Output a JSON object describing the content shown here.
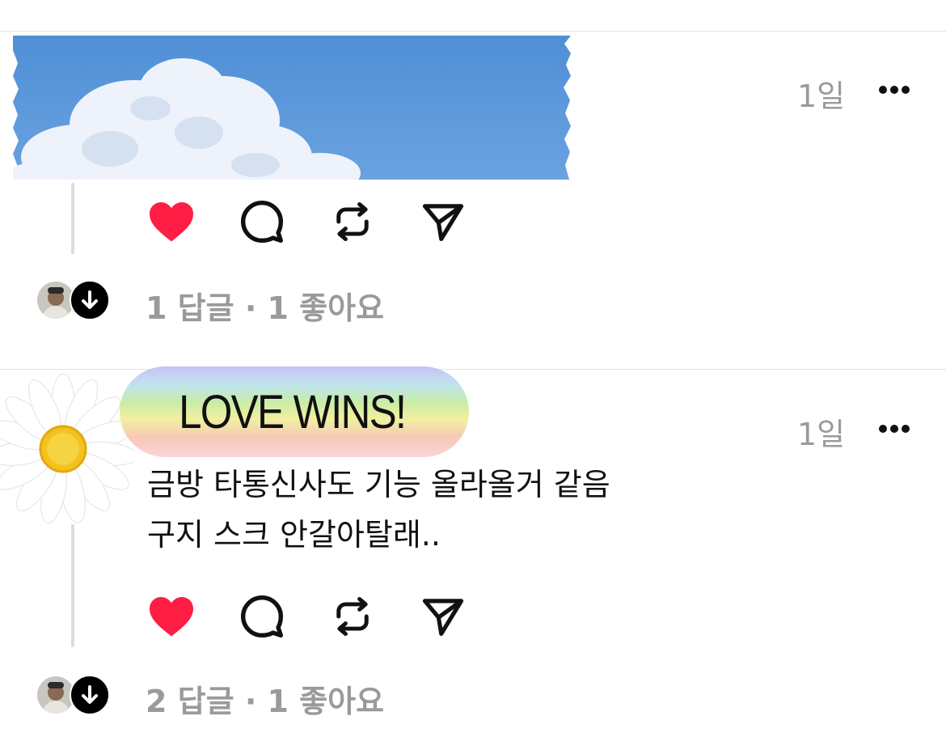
{
  "posts": [
    {
      "time": "1일",
      "more_icon": "more-horizontal-icon",
      "liked": true,
      "stats": "1 답글 · 1 좋아요"
    },
    {
      "badge": "LOVE WINS!",
      "time": "1일",
      "more_icon": "more-horizontal-icon",
      "text_lines": [
        "금방 타통신사도 기능 올라올거 같음",
        "구지 스크 안갈아탈래.."
      ],
      "liked": true,
      "stats": "2 답글 · 1 좋아요"
    }
  ],
  "colors": {
    "like": "#ff1d43",
    "muted": "#9a9a9a",
    "sky": "#5a96d8"
  }
}
